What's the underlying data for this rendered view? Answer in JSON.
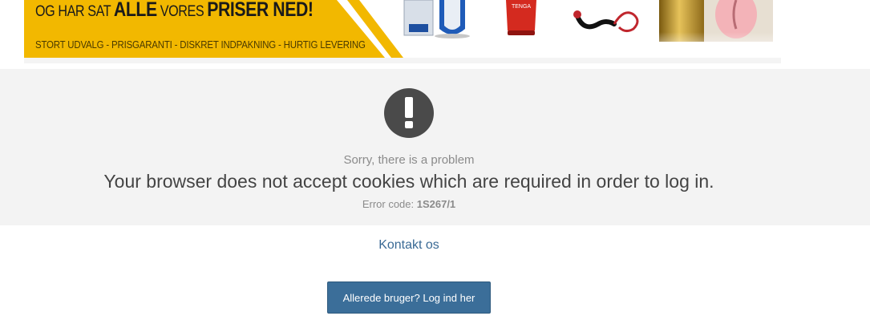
{
  "banner": {
    "headline_part1": "OG HAR SAT ",
    "headline_bold1": "ALLE",
    "headline_part2": " VORES ",
    "headline_bold2": "PRISER NED!",
    "subline": "STORT UDVALG - PRISGARANTI - DISKRET INDPAKNING  - HURTIG LEVERING",
    "product_label": "TENGA",
    "accent_color": "#f2b800"
  },
  "error": {
    "title": "Sorry, there is a problem",
    "message": "Your browser does not accept cookies which are required in order to log in.",
    "code_label": "Error code: ",
    "code_value": "1S267/1",
    "icon": "exclamation-icon"
  },
  "links": {
    "contact": "Kontakt os",
    "login_button": "Allerede bruger? Log ind her"
  }
}
